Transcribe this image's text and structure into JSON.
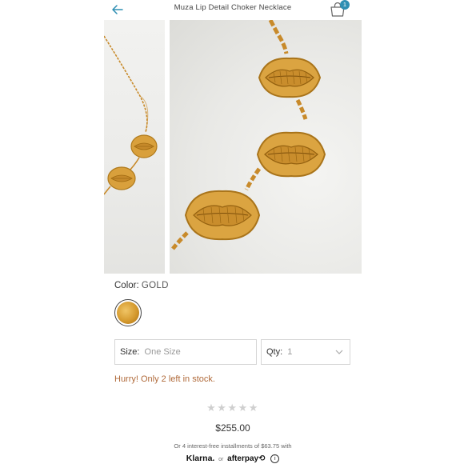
{
  "header": {
    "title": "Muza Lip Detail Choker Necklace",
    "bag_count": "1"
  },
  "product": {
    "color_label": "Color:",
    "color_value": "GOLD",
    "size_label": "Size:",
    "size_value": "One Size",
    "qty_label": "Qty:",
    "qty_value": "1",
    "stock_message": "Hurry! Only 2 left in stock.",
    "rating_stars": "★★★★★",
    "price": "$255.00",
    "installments_text": "Or 4 interest-free installments of $63.75 with",
    "klarna_label": "Klarna.",
    "or_label": "or",
    "afterpay_label": "afterpay⟲",
    "info_icon": "i"
  },
  "colors": {
    "accent": "#2f8fb3",
    "stock_text": "#b06a3a",
    "gold": "#d59a2e"
  }
}
